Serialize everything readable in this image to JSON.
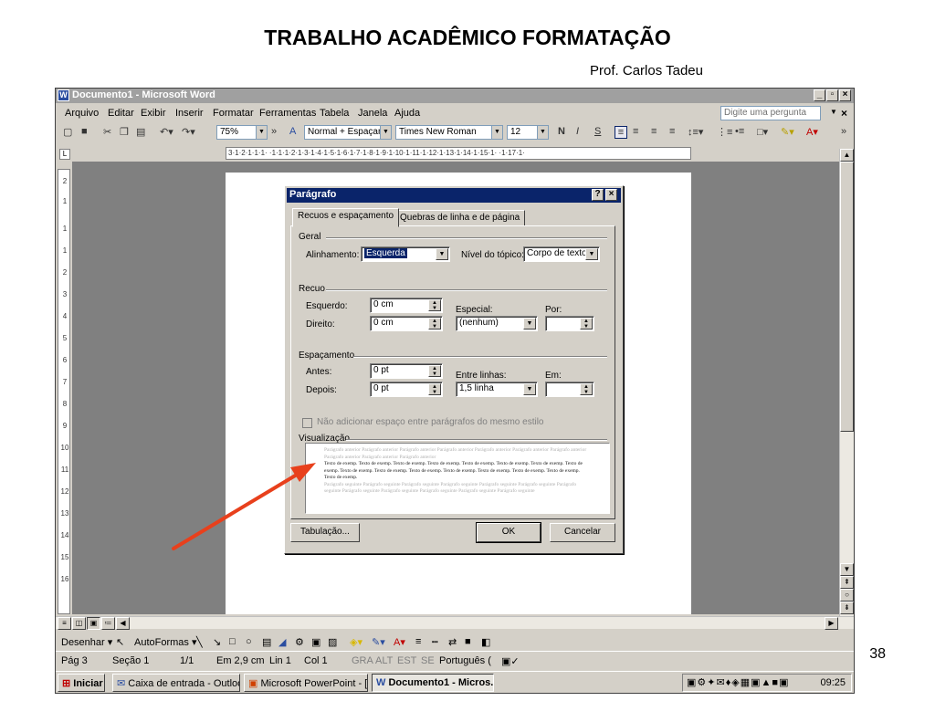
{
  "slide": {
    "title": "TRABALHO ACADÊMICO FORMATAÇÃO",
    "author": "Prof. Carlos Tadeu",
    "number": "38"
  },
  "window": {
    "title": "Documento1 - Microsoft Word",
    "menu": [
      "Arquivo",
      "Editar",
      "Exibir",
      "Inserir",
      "Formatar",
      "Ferramentas",
      "Tabela",
      "Janela",
      "Ajuda"
    ],
    "ask_placeholder": "Digite uma pergunta"
  },
  "toolbar": {
    "zoom": "75%",
    "style": "Normal + Espaçamento",
    "font": "Times New Roman",
    "size": "12",
    "bold": "N",
    "italic": "I",
    "underline": "S"
  },
  "ruler": {
    "horizontal": "3·1·2·1·1·1· ·1·1·1·2·1·3·1·4·1·5·1·6·1·7·1·8·1·9·1·10·1·11·1·12·1·13·1·14·1·15·1· ·1·17·1·",
    "vertical": [
      "2",
      "1",
      "1",
      "1",
      "2",
      "3",
      "4",
      "5",
      "6",
      "7",
      "8",
      "9",
      "10",
      "11",
      "12",
      "13",
      "14",
      "15",
      "16"
    ]
  },
  "dialog": {
    "title": "Parágrafo",
    "tabs": [
      "Recuos e espaçamento",
      "Quebras de linha e de página"
    ],
    "general": {
      "label": "Geral",
      "alignment_label": "Alinhamento:",
      "alignment_value": "Esquerda",
      "outline_label": "Nível do tópico:",
      "outline_value": "Corpo de texto"
    },
    "indent": {
      "label": "Recuo",
      "left_label": "Esquerdo:",
      "left_value": "0 cm",
      "right_label": "Direito:",
      "right_value": "0 cm",
      "special_label": "Especial:",
      "special_value": "(nenhum)",
      "by_label": "Por:",
      "by_value": ""
    },
    "spacing": {
      "label": "Espaçamento",
      "before_label": "Antes:",
      "before_value": "0 pt",
      "after_label": "Depois:",
      "after_value": "0 pt",
      "line_label": "Entre linhas:",
      "line_value": "1,5 linha",
      "at_label": "Em:",
      "at_value": ""
    },
    "no_space_checkbox": "Não adicionar espaço entre parágrafos do mesmo estilo",
    "preview_label": "Visualização",
    "preview_prev": "Parágrafo anterior Parágrafo anterior Parágrafo anterior Parágrafo anterior Parágrafo anterior Parágrafo anterior Parágrafo anterior Parágrafo anterior Parágrafo anterior Parágrafo anterior",
    "preview_sample": "Texto de exemp. Texto de exemp. Texto de exemp. Texto de exemp. Texto de exemp. Texto de exemp. Texto de exemp. Texto de exemp. Texto de exemp. Texto de exemp. Texto de exemp. Texto de exemp. Texto de exemp. Texto de exemp. Texto de exemp. Texto de exemp.",
    "preview_next": "Parágrafo seguinte Parágrafo seguinte Parágrafo seguinte Parágrafo seguinte Parágrafo seguinte Parágrafo seguinte Parágrafo seguinte Parágrafo seguinte Parágrafo seguinte Parágrafo seguinte Parágrafo seguinte Parágrafo seguinte",
    "tabs_button": "Tabulação...",
    "ok_button": "OK",
    "cancel_button": "Cancelar"
  },
  "drawbar": {
    "draw": "Desenhar ▾",
    "autoshapes": "AutoFormas ▾"
  },
  "status": {
    "page": "Pág 3",
    "section": "Seção 1",
    "pages": "1/1",
    "at": "Em 2,9 cm",
    "line": "Lin 1",
    "col": "Col 1",
    "rec": "GRA",
    "trk": "ALT",
    "ext": "EST",
    "ovr": "SE",
    "lang": "Português ("
  },
  "taskbar": {
    "start": "Iniciar",
    "tasks": [
      "Caixa de entrada - Outlook...",
      "Microsoft PowerPoint - [Me...",
      "Documento1 - Micros..."
    ],
    "clock": "09:25"
  },
  "colors": {
    "arrow": "#e8401c",
    "dialog_title": "#0a246a",
    "window_title_inactive": "#a0a0a0"
  }
}
